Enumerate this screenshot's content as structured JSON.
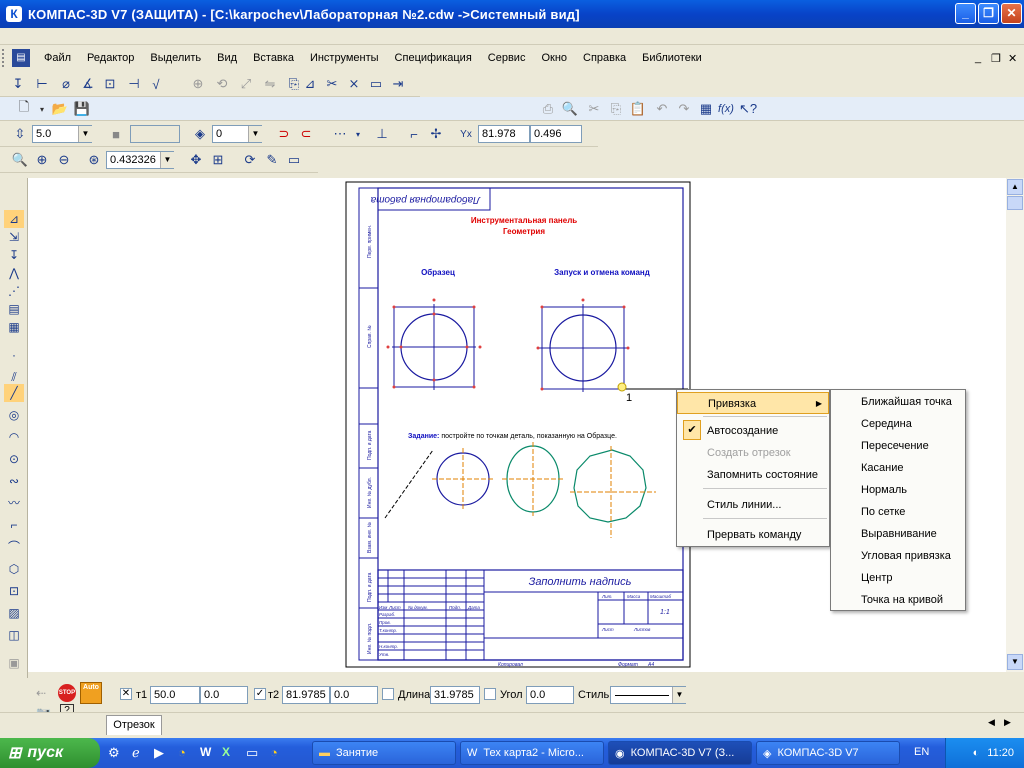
{
  "window": {
    "title": "КОМПАС-3D V7 (ЗАЩИТА) - [C:\\karpochev\\Лабораторная №2.cdw ->Системный вид]",
    "app_icon": "К"
  },
  "menu": [
    {
      "label": "Файл"
    },
    {
      "label": "Редактор"
    },
    {
      "label": "Выделить"
    },
    {
      "label": "Вид"
    },
    {
      "label": "Вставка"
    },
    {
      "label": "Инструменты"
    },
    {
      "label": "Спецификация"
    },
    {
      "label": "Сервис"
    },
    {
      "label": "Окно"
    },
    {
      "label": "Справка"
    },
    {
      "label": "Библиотеки"
    }
  ],
  "toolbar_props": {
    "step": "5.0",
    "layer": "0",
    "coord_x": "81.978",
    "coord_y": "0.496"
  },
  "toolbar_view": {
    "zoom": "0.432326"
  },
  "drawing": {
    "stamp_top": "Лабораторная работа",
    "heading_line1": "Инструментальная панель",
    "heading_line2": "Геометрия",
    "label_sample": "Образец",
    "label_snap": "Запуск и отмена команд",
    "task_label": "Задание:",
    "task_text": "постройте по точкам деталь, показанную на Образце.",
    "fill_title": "Заполнить надпись",
    "sheet_count": "1:1",
    "copied": "Копировал",
    "format": "Формат",
    "format_value": "А4",
    "point_label": "1",
    "tb_cols": [
      "Изм",
      "Лист",
      "№ докум.",
      "Подп.",
      "Дата"
    ],
    "tb_rows": [
      "Разраб.",
      "Пров.",
      "Т.контр.",
      "Н.контр.",
      "Утв."
    ],
    "tb_lit": "Лит.",
    "tb_mass": "Масса",
    "tb_scale": "Масштаб",
    "tb_sheet": "Лист",
    "tb_sheets": "Листов",
    "side_labels": [
      "Перв. примен.",
      "Справ. №",
      "Подп. и дата",
      "Инв. № дубл.",
      "Взам. инв. №",
      "Подп. и дата",
      "Инв. № подл."
    ]
  },
  "context_menu": {
    "items": [
      {
        "label": "Привязка",
        "has_sub": true,
        "selected": true
      },
      {
        "label": "Автосоздание",
        "checked": true
      },
      {
        "label": "Создать отрезок",
        "disabled": true
      },
      {
        "label": "Запомнить состояние"
      },
      {
        "label": "Стиль линии..."
      },
      {
        "label": "Прервать команду"
      }
    ],
    "submenu": [
      {
        "label": "Ближайшая точка"
      },
      {
        "label": "Середина"
      },
      {
        "label": "Пересечение"
      },
      {
        "label": "Касание"
      },
      {
        "label": "Нормаль"
      },
      {
        "label": "По сетке"
      },
      {
        "label": "Выравнивание"
      },
      {
        "label": "Угловая привязка"
      },
      {
        "label": "Центр"
      },
      {
        "label": "Точка на кривой"
      }
    ]
  },
  "status": {
    "stop_label": "STOP",
    "auto_label": "Auto",
    "t1_label": "т1",
    "t1_x": "50.0",
    "t1_y": "0.0",
    "t2_label": "т2",
    "t2_x": "81.9785",
    "t2_y": "0.0",
    "length_label": "Длина",
    "length_value": "31.9785",
    "angle_label": "Угол",
    "angle_value": "0.0",
    "style_label": "Стиль"
  },
  "bottom_tab": {
    "label": "Отрезок"
  },
  "taskbar": {
    "start": "пуск",
    "tasks": [
      {
        "label": "Занятие"
      },
      {
        "label": "Тех карта2 - Micro..."
      },
      {
        "label": "КОМПАС-3D V7 (З..."
      },
      {
        "label": "КОМПАС-3D V7"
      }
    ],
    "lang": "EN",
    "time": "11:20"
  }
}
